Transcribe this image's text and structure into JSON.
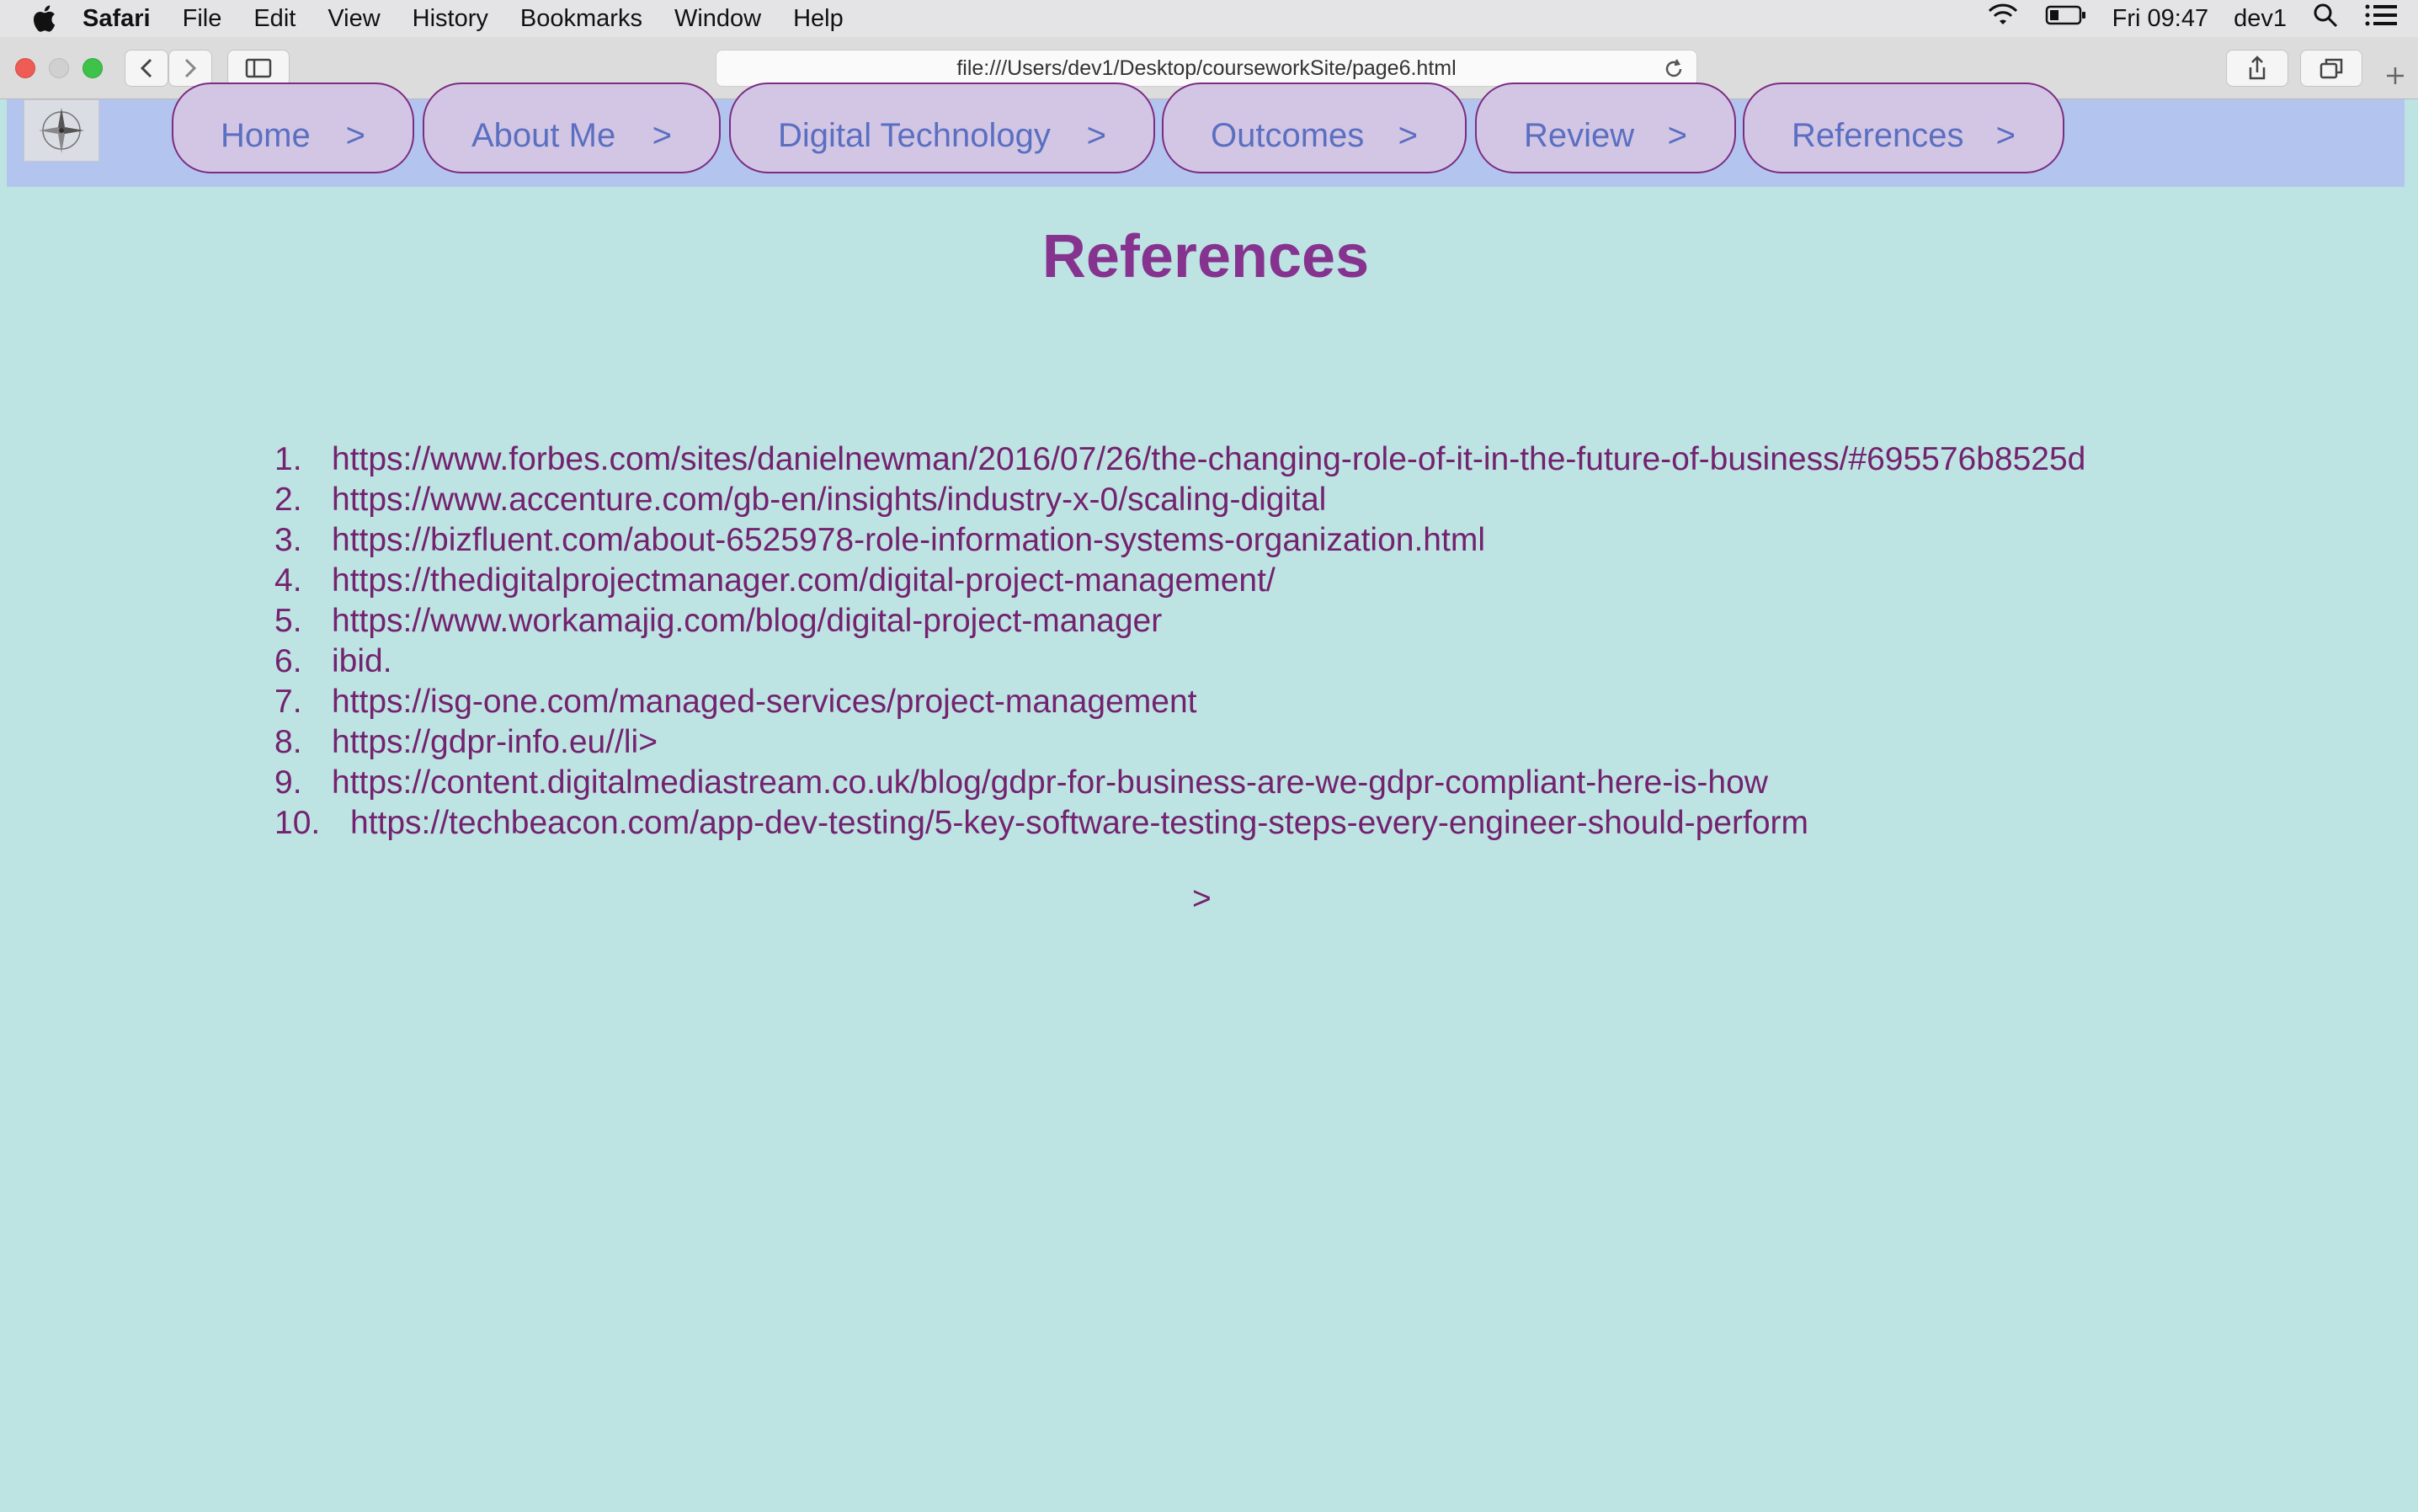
{
  "menubar": {
    "app": "Safari",
    "items": [
      "File",
      "Edit",
      "View",
      "History",
      "Bookmarks",
      "Window",
      "Help"
    ],
    "clock": "Fri 09:47",
    "user": "dev1"
  },
  "browser": {
    "url": "file:///Users/dev1/Desktop/courseworkSite/page6.html"
  },
  "nav": {
    "items": [
      {
        "label": "Home",
        "arrow": ">"
      },
      {
        "label": "About Me",
        "arrow": ">"
      },
      {
        "label": "Digital Technology",
        "arrow": ">"
      },
      {
        "label": "Outcomes",
        "arrow": ">"
      },
      {
        "label": "Review",
        "arrow": ">"
      },
      {
        "label": "References",
        "arrow": ">"
      }
    ]
  },
  "page": {
    "title": "References",
    "references": [
      {
        "num": "1.",
        "text": "https://www.forbes.com/sites/danielnewman/2016/07/26/the-changing-role-of-it-in-the-future-of-business/#695576b8525d"
      },
      {
        "num": "2.",
        "text": "https://www.accenture.com/gb-en/insights/industry-x-0/scaling-digital"
      },
      {
        "num": "3.",
        "text": "https://bizfluent.com/about-6525978-role-information-systems-organization.html"
      },
      {
        "num": "4.",
        "text": "https://thedigitalprojectmanager.com/digital-project-management/"
      },
      {
        "num": "5.",
        "text": "https://www.workamajig.com/blog/digital-project-manager"
      },
      {
        "num": "6.",
        "text": "ibid."
      },
      {
        "num": "7.",
        "text": "https://isg-one.com/managed-services/project-management"
      },
      {
        "num": "8.",
        "text": "https://gdpr-info.eu//li>"
      },
      {
        "num": "9.",
        "text": "https://content.digitalmediastream.co.uk/blog/gdpr-for-business-are-we-gdpr-compliant-here-is-how"
      },
      {
        "num": "10.",
        "text": "https://techbeacon.com/app-dev-testing/5-key-software-testing-steps-every-engineer-should-perform"
      }
    ],
    "next_arrow": ">"
  },
  "colors": {
    "page_bg": "#bde3e2",
    "nav_bg": "#b3c5ee",
    "nav_button_bg": "#d3c6e4",
    "nav_text": "#5a6fc1",
    "title": "#86338f",
    "link": "#73226f"
  }
}
